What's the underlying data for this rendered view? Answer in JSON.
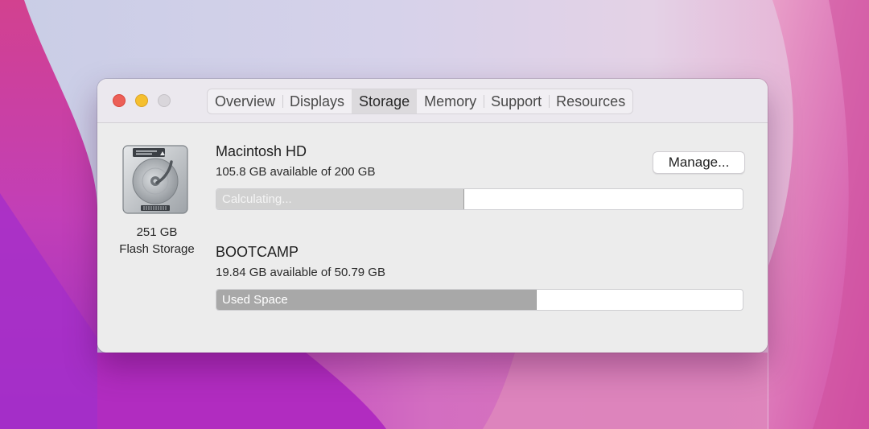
{
  "window": {
    "traffic_lights": {
      "close": "#ec5f57",
      "minimize": "#f5bf2e",
      "zoom": "#d9d6db"
    }
  },
  "tabs": [
    {
      "label": "Overview",
      "active": false
    },
    {
      "label": "Displays",
      "active": false
    },
    {
      "label": "Storage",
      "active": true
    },
    {
      "label": "Memory",
      "active": false
    },
    {
      "label": "Support",
      "active": false
    },
    {
      "label": "Resources",
      "active": false
    }
  ],
  "storage": {
    "disk_icon": "hard-drive-icon",
    "disk_size": "251 GB",
    "disk_type": "Flash Storage",
    "manage_label": "Manage...",
    "volumes": [
      {
        "name": "Macintosh HD",
        "available": "105.8 GB available of 200 GB",
        "bar_label": "Calculating...",
        "bar_fraction": 0.471
      },
      {
        "name": "BOOTCAMP",
        "available": "19.84 GB available of 50.79 GB",
        "bar_label": "Used Space",
        "bar_fraction": 0.609
      }
    ]
  }
}
